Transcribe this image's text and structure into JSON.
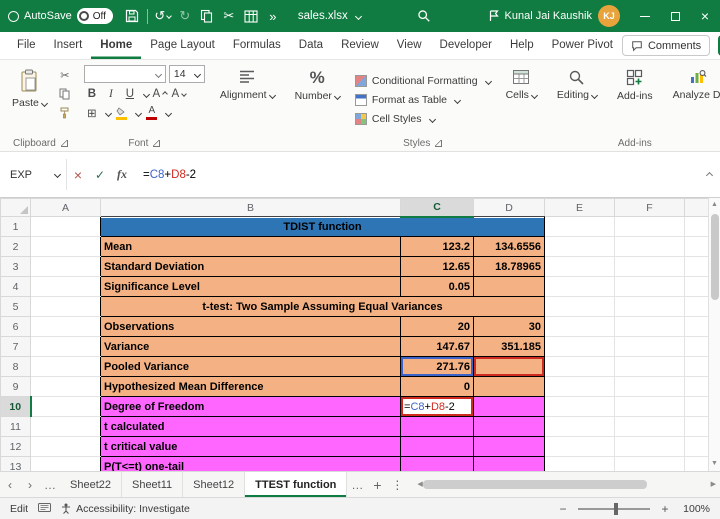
{
  "colors": {
    "excel-green": "#107C41",
    "header-blue": "#2E75B6",
    "table-orange": "#F4B183",
    "table-pink": "#FF66FF",
    "ref-blue": "#3C64C8",
    "ref-red": "#D02B20",
    "avatar-gold": "#E8A33C"
  },
  "titlebar": {
    "autosave_label": "AutoSave",
    "autosave_state": "Off",
    "filename": "sales.xlsx",
    "user_name": "Kunal Jai Kaushik",
    "user_initials": "KJ"
  },
  "menubar": {
    "tabs": [
      "File",
      "Insert",
      "Home",
      "Page Layout",
      "Formulas",
      "Data",
      "Review",
      "View",
      "Developer",
      "Help",
      "Power Pivot"
    ],
    "active_tab": "Home",
    "comments_label": "Comments"
  },
  "ribbon": {
    "paste_label": "Paste",
    "clipboard_group_label": "Clipboard",
    "font_group_label": "Font",
    "font_name_value": "",
    "font_size_value": "14",
    "alignment_label": "Alignment",
    "number_label": "Number",
    "styles_items": [
      "Conditional Formatting",
      "Format as Table",
      "Cell Styles"
    ],
    "styles_group_label": "Styles",
    "cells_label": "Cells",
    "editing_label": "Editing",
    "addins_label": "Add-ins",
    "addins_group_label": "Add-ins",
    "analyze_data_label": "Analyze Data"
  },
  "formula_bar": {
    "name_box_value": "EXP",
    "formula_parts": [
      {
        "text": "=",
        "color": "#000000"
      },
      {
        "text": "C8",
        "color": "#3C64C8"
      },
      {
        "text": "+",
        "color": "#000000"
      },
      {
        "text": "D8",
        "color": "#D02B20"
      },
      {
        "text": "-2",
        "color": "#000000"
      }
    ]
  },
  "grid": {
    "column_headers": [
      "A",
      "B",
      "C",
      "D",
      "E",
      "F"
    ],
    "active_column": "C",
    "active_row": 10,
    "rows": [
      {
        "n": 1,
        "label": "TDIST function",
        "c": "",
        "d": "",
        "fill": "blue",
        "merged": true
      },
      {
        "n": 2,
        "label": "Mean",
        "c": "123.2",
        "d": "134.6556",
        "fill": "orange"
      },
      {
        "n": 3,
        "label": "Standard Deviation",
        "c": "12.65",
        "d": "18.78965",
        "fill": "orange"
      },
      {
        "n": 4,
        "label": "Significance Level",
        "c": "0.05",
        "d": "",
        "fill": "orange"
      },
      {
        "n": 5,
        "label": "t-test: Two Sample Assuming Equal Variances",
        "c": "",
        "d": "",
        "fill": "orange",
        "merged": true
      },
      {
        "n": 6,
        "label": "Observations",
        "c": "20",
        "d": "30",
        "fill": "orange"
      },
      {
        "n": 7,
        "label": "Variance",
        "c": "147.67",
        "d": "351.185",
        "fill": "orange"
      },
      {
        "n": 8,
        "label": "Pooled Variance",
        "c": "271.76",
        "d": "",
        "fill": "orange",
        "c_ref": "blue",
        "d_ref": "red"
      },
      {
        "n": 9,
        "label": "Hypothesized Mean Difference",
        "c": "0",
        "d": "",
        "fill": "orange"
      },
      {
        "n": 10,
        "label": "Degree of Freedom",
        "c": "",
        "d": "",
        "fill": "pink",
        "editing": true
      },
      {
        "n": 11,
        "label": "t calculated",
        "c": "",
        "d": "",
        "fill": "pink"
      },
      {
        "n": 12,
        "label": "t critical value",
        "c": "",
        "d": "",
        "fill": "pink"
      },
      {
        "n": 13,
        "label": "P(T<=t) one-tail",
        "c": "",
        "d": "",
        "fill": "pink"
      }
    ]
  },
  "sheet_tabs": {
    "tabs": [
      "Sheet22",
      "Sheet11",
      "Sheet12",
      "TTEST function"
    ],
    "active": "TTEST function"
  },
  "status_bar": {
    "mode_label": "Edit",
    "accessibility_label": "Accessibility: Investigate",
    "zoom_value": "100%"
  }
}
